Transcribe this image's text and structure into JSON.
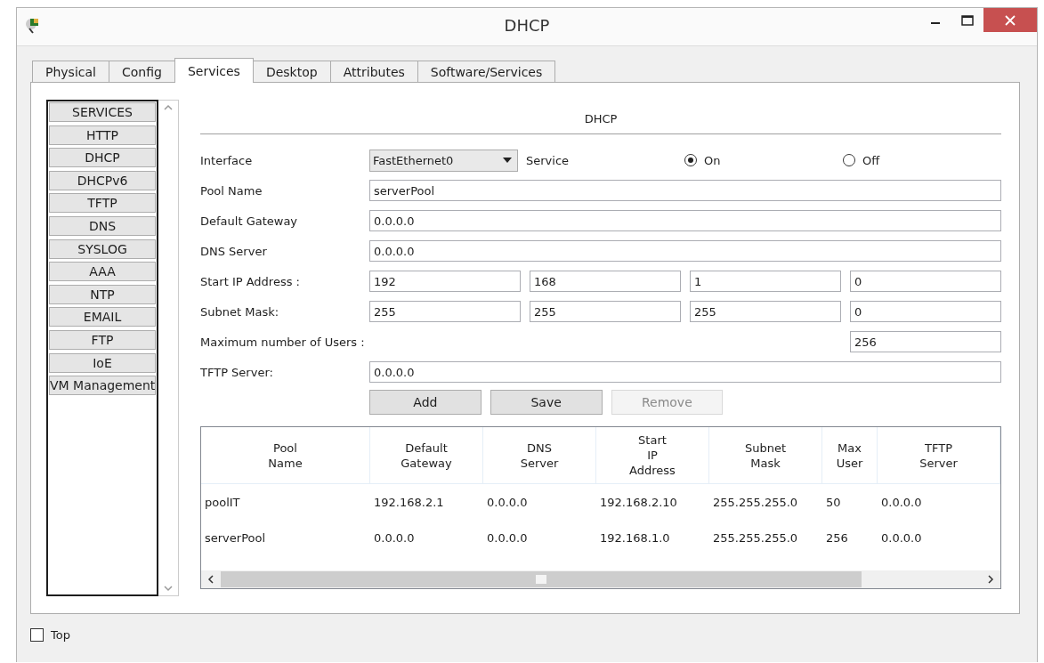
{
  "window": {
    "title": "DHCP"
  },
  "tabs": [
    {
      "label": "Physical",
      "selected": false
    },
    {
      "label": "Config",
      "selected": false
    },
    {
      "label": "Services",
      "selected": true
    },
    {
      "label": "Desktop",
      "selected": false
    },
    {
      "label": "Attributes",
      "selected": false
    },
    {
      "label": "Software/Services",
      "selected": false
    }
  ],
  "sidebar": {
    "items": [
      "SERVICES",
      "HTTP",
      "DHCP",
      "DHCPv6",
      "TFTP",
      "DNS",
      "SYSLOG",
      "AAA",
      "NTP",
      "EMAIL",
      "FTP",
      "IoE",
      "VM Management"
    ]
  },
  "panel": {
    "heading": "DHCP",
    "interface": {
      "label": "Interface",
      "value": "FastEthernet0"
    },
    "service": {
      "label": "Service",
      "options": [
        {
          "label": "On",
          "selected": true
        },
        {
          "label": "Off",
          "selected": false
        }
      ]
    },
    "fields": [
      {
        "kind": "wide",
        "label": "Pool Name",
        "values": [
          "serverPool"
        ]
      },
      {
        "kind": "wide",
        "label": "Default Gateway",
        "values": [
          "0.0.0.0"
        ]
      },
      {
        "kind": "wide",
        "label": "DNS Server",
        "values": [
          "0.0.0.0"
        ]
      },
      {
        "kind": "quad",
        "label": "Start IP Address :",
        "values": [
          "192",
          "168",
          "1",
          "0"
        ]
      },
      {
        "kind": "quad",
        "label": "Subnet Mask:",
        "values": [
          "255",
          "255",
          "255",
          "0"
        ]
      },
      {
        "kind": "right",
        "label": "Maximum number of Users :",
        "values": [
          "256"
        ]
      },
      {
        "kind": "wide",
        "label": "TFTP Server:",
        "values": [
          "0.0.0.0"
        ]
      }
    ],
    "buttons": [
      {
        "label": "Add",
        "disabled": false
      },
      {
        "label": "Save",
        "disabled": false
      },
      {
        "label": "Remove",
        "disabled": true
      }
    ],
    "table": {
      "columns": [
        "Pool\nName",
        "Default\nGateway",
        "DNS\nServer",
        "Start\nIP\nAddress",
        "Subnet\nMask",
        "Max\nUser",
        "TFTP\nServer"
      ],
      "rows": [
        [
          "poolIT",
          "192.168.2.1",
          "0.0.0.0",
          "192.168.2.10",
          "255.255.255.0",
          "50",
          "0.0.0.0"
        ],
        [
          "serverPool",
          "0.0.0.0",
          "0.0.0.0",
          "192.168.1.0",
          "255.255.255.0",
          "256",
          "0.0.0.0"
        ]
      ]
    }
  },
  "top_checkbox": {
    "label": "Top",
    "checked": false
  }
}
